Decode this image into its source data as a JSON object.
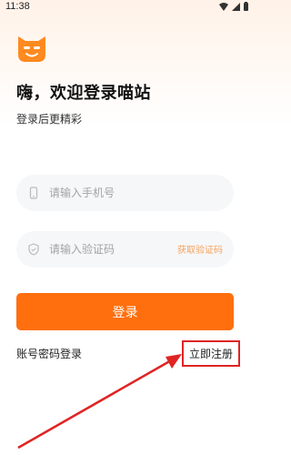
{
  "status_bar": {
    "time": "11:38",
    "icons": [
      "wifi-icon",
      "signal-icon",
      "battery-icon"
    ]
  },
  "app": {
    "logo_icon": "cat-logo-icon",
    "title": "嗨，欢迎登录喵站",
    "subtitle": "登录后更精彩",
    "accent_color": "#ff6f0e"
  },
  "form": {
    "phone": {
      "placeholder": "请输入手机号",
      "value": "",
      "icon": "phone-icon"
    },
    "code": {
      "placeholder": "请输入验证码",
      "value": "",
      "icon": "shield-icon"
    },
    "get_code_label": "获取验证码"
  },
  "actions": {
    "login_label": "登录",
    "password_login_label": "账号密码登录",
    "register_label": "立即注册"
  },
  "annotation": {
    "highlight_color": "#e02424"
  }
}
